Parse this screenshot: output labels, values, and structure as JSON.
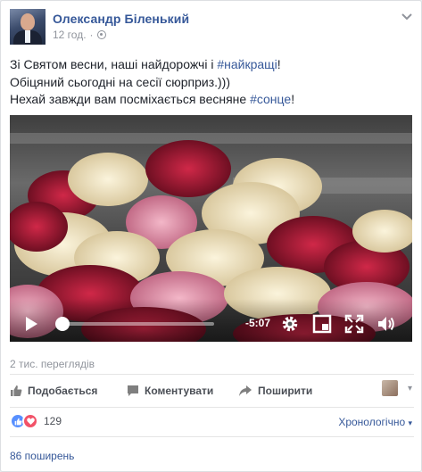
{
  "post": {
    "author": "Олександр Біленький",
    "time": "12 год.",
    "privacy_icon": "globe-icon",
    "options_icon": "chevron-down-icon",
    "text_lines": [
      {
        "before": "Зі Святом весни, наші найдорожчі і ",
        "tag": "#найкращі",
        "after": "!"
      },
      {
        "before": "Обіцяний сьогодні на сесії сюрприз.)))",
        "tag": "",
        "after": ""
      },
      {
        "before": "Нехай завжди вам посміхається весняне ",
        "tag": "#сонце",
        "after": "!"
      }
    ]
  },
  "video": {
    "remaining_time": "-5:07",
    "progress": 0.0,
    "controls": [
      "play-icon",
      "settings-icon",
      "popout-icon",
      "fullscreen-icon",
      "volume-icon"
    ]
  },
  "views": "2 тис. переглядів",
  "actions": {
    "like": "Подобається",
    "comment": "Коментувати",
    "share": "Поширити"
  },
  "reactions": {
    "count": "129",
    "types": [
      "like-icon",
      "love-icon"
    ]
  },
  "sort_label": "Хронологічно",
  "shares": "86 поширень",
  "colors": {
    "link": "#365899",
    "muted": "#90949c",
    "like": "#5890ff",
    "love": "#f25268"
  }
}
